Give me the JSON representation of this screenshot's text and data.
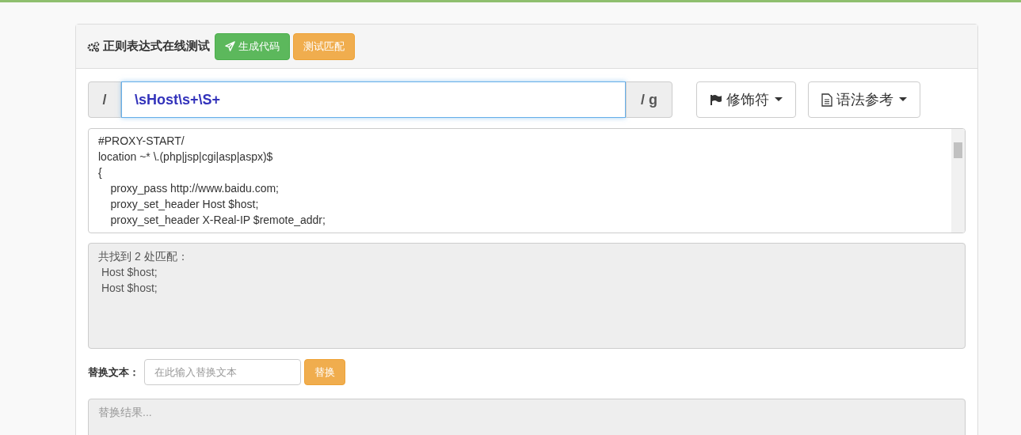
{
  "panel": {
    "title": "正则表达式在线测试",
    "buttons": [
      {
        "label": "生成代码",
        "kind": "success"
      },
      {
        "label": "测试匹配",
        "kind": "warning"
      }
    ]
  },
  "regex": {
    "prefix": "/",
    "value": "\\sHost\\s+\\S+",
    "suffix": "/ g"
  },
  "menus": [
    {
      "label": "修饰符",
      "kind": "flag"
    },
    {
      "label": "语法参考",
      "kind": "document"
    }
  ],
  "source_text": {
    "lines": [
      "#PROXY-START/",
      "location ~* \\.(php|jsp|cgi|asp|aspx)$",
      "{",
      "\tproxy_pass http://www.baidu.com;",
      "    proxy_set_header Host $host;",
      "    proxy_set_header X-Real-IP $remote_addr;"
    ]
  },
  "result": {
    "lines": [
      "共找到 2 处匹配：",
      " Host $host;",
      " Host $host;"
    ]
  },
  "replace": {
    "label": "替换文本：",
    "placeholder": "在此输入替换文本",
    "button": "替换"
  },
  "replace_result": {
    "placeholder": "替换结果..."
  }
}
